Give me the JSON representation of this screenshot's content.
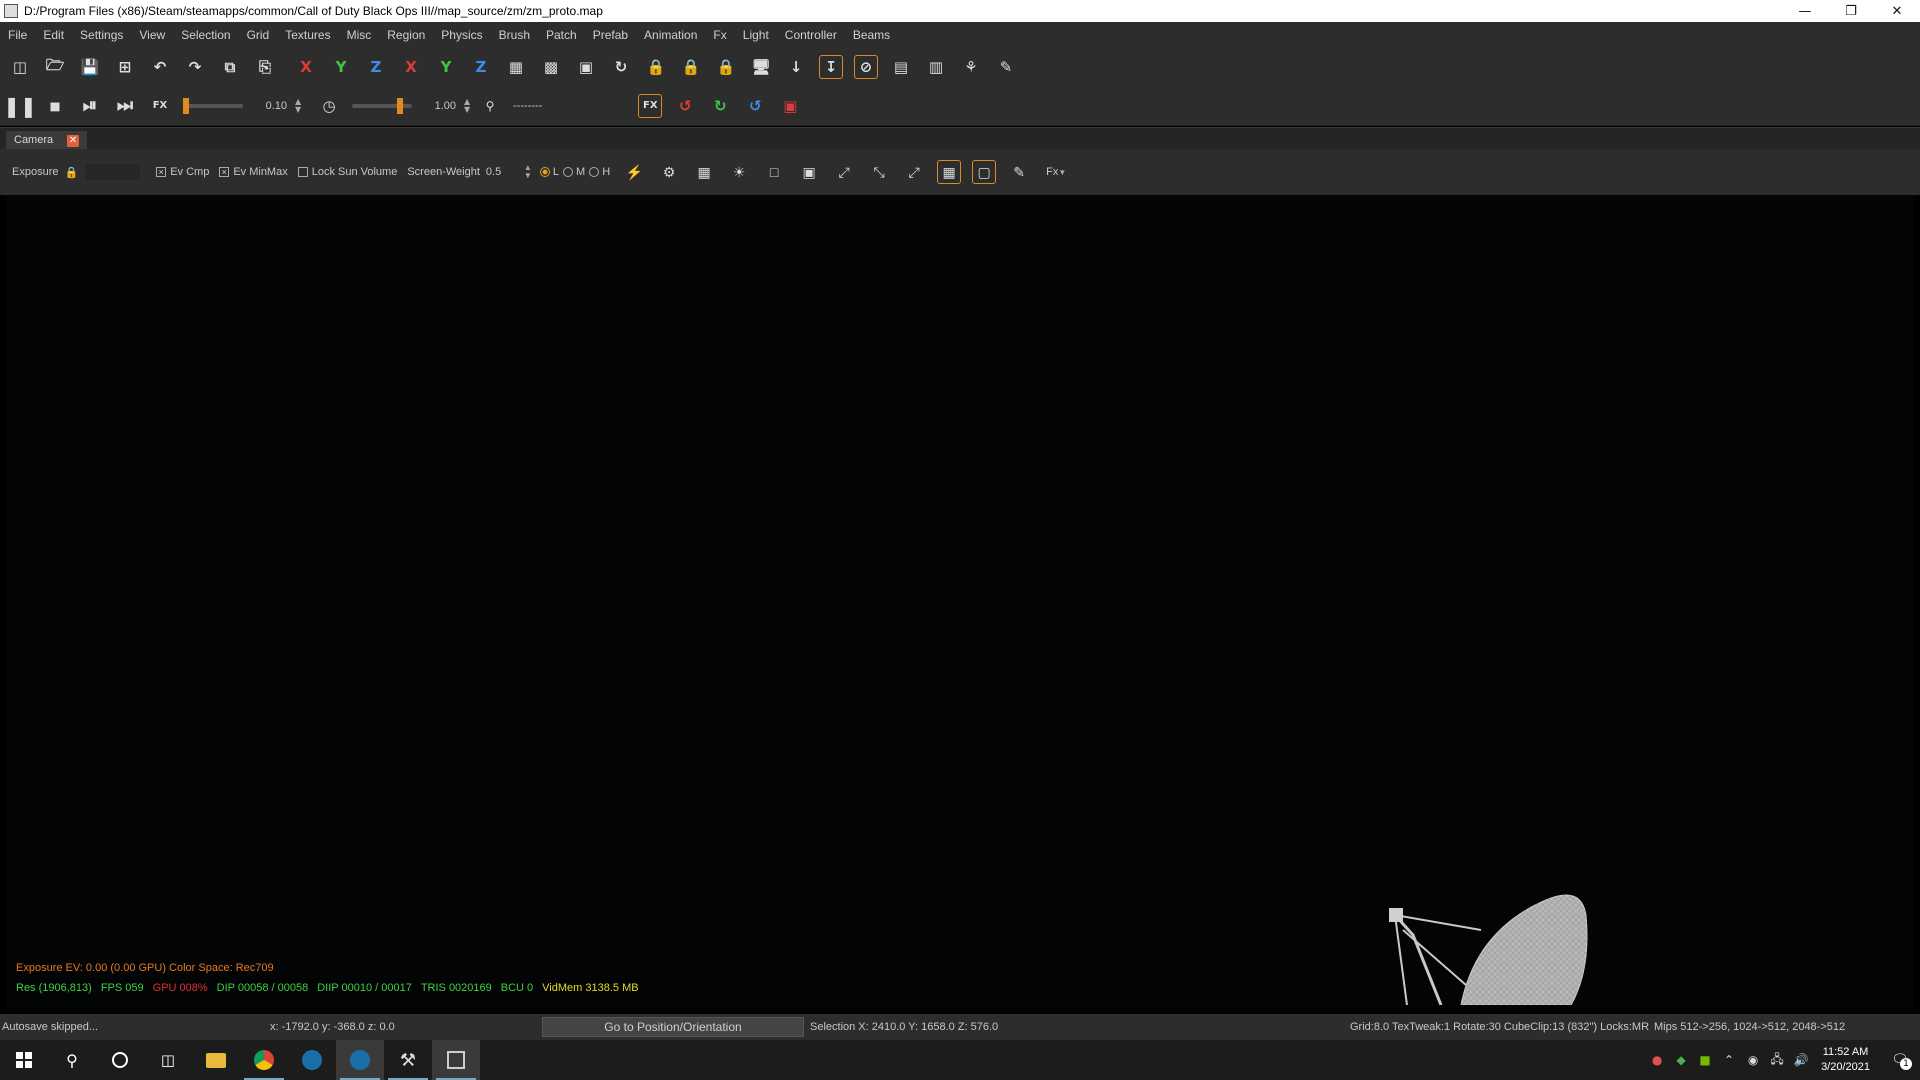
{
  "window": {
    "title": "D:/Program Files (x86)/Steam/steamapps/common/Call of Duty Black Ops III//map_source/zm/zm_proto.map"
  },
  "menu": [
    "File",
    "Edit",
    "Settings",
    "View",
    "Selection",
    "Grid",
    "Textures",
    "Misc",
    "Region",
    "Physics",
    "Brush",
    "Patch",
    "Prefab",
    "Animation",
    "Fx",
    "Light",
    "Controller",
    "Beams"
  ],
  "playback": {
    "fx_time_value": "0.10",
    "speed_value": "1.00",
    "speed_dashes": "--------"
  },
  "camera_panel": {
    "tab_label": "Camera",
    "exposure_label": "Exposure",
    "ev_cmp_label": "Ev Cmp",
    "ev_minmax_label": "Ev MinMax",
    "lock_sun_label": "Lock Sun Volume",
    "screen_weight_label": "Screen-Weight",
    "screen_weight_value": "0.5",
    "quality_options": [
      "L",
      "M",
      "H"
    ],
    "fx_menu_label": "Fx"
  },
  "viewport": {
    "overlay_line1": "Exposure EV: 0.00 (0.00 GPU)   Color Space: Rec709",
    "stats": [
      {
        "text": "Res (1906,813)",
        "color": "#3fd13f"
      },
      {
        "text": "FPS 059",
        "color": "#3fd13f"
      },
      {
        "text": "GPU 008%",
        "color": "#e03030"
      },
      {
        "text": "DIP 00058 / 00058",
        "color": "#3fd13f"
      },
      {
        "text": "DIIP 00010 / 00017",
        "color": "#3fd13f"
      },
      {
        "text": "TRIS 0020169",
        "color": "#3fd13f"
      },
      {
        "text": "BCU 0",
        "color": "#3fd13f"
      },
      {
        "text": "VidMem 3138.5 MB",
        "color": "#e8d820"
      }
    ]
  },
  "status": {
    "autosave": "Autosave skipped...",
    "coords": "x: -1792.0   y: -368.0   z: 0.0",
    "goto_button": "Go to Position/Orientation",
    "selection": "Selection X: 2410.0  Y: 1658.0  Z: 576.0",
    "grid_info": "Grid:8.0 TexTweak:1 Rotate:30 CubeClip:13 (832\") Locks:MR",
    "mips": "Mips 512->256, 1024->512, 2048->512"
  },
  "taskbar": {
    "time": "11:52 AM",
    "date": "3/20/2021",
    "notification_count": "1"
  }
}
